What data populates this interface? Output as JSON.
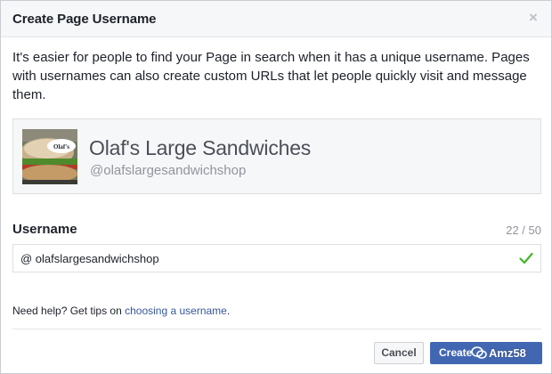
{
  "dialog": {
    "title": "Create Page Username",
    "close_glyph": "×",
    "intro": "It's easier for people to find your Page in search when it has a unique username. Pages with usernames can also create custom URLs that let people quickly visit and message them."
  },
  "page_card": {
    "thumb_label": "Olaf's",
    "name": "Olaf's Large Sandwiches",
    "handle": "@olafslargesandwichshop"
  },
  "username": {
    "label": "Username",
    "count": "22 / 50",
    "value": "@ olafslargesandwichshop",
    "valid_icon": "checkmark-icon",
    "valid_color": "#42b72a"
  },
  "help": {
    "prefix": "Need help? Get tips on ",
    "link": "choosing a username",
    "suffix": "."
  },
  "buttons": {
    "cancel": "Cancel",
    "create": "Create"
  },
  "watermark": {
    "text": "Amz58"
  },
  "colors": {
    "accent": "#4267b2",
    "link": "#365899",
    "header_bg": "#f6f7f9"
  }
}
